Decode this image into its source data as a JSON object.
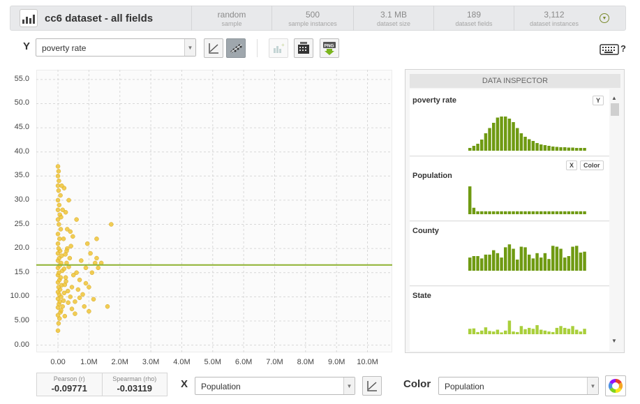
{
  "header": {
    "title": "cc6 dataset - all fields",
    "stats": [
      {
        "value": "random",
        "label": "sample"
      },
      {
        "value": "500",
        "label": "sample instances"
      },
      {
        "value": "3.1 MB",
        "label": "dataset size"
      },
      {
        "value": "189",
        "label": "dataset fields"
      },
      {
        "value": "3,112",
        "label": "dataset instances"
      }
    ]
  },
  "toolbar": {
    "y_letter": "Y",
    "y_field": "poverty rate",
    "x_letter": "X",
    "x_field": "Population",
    "color_label": "Color",
    "color_field": "Population",
    "keyboard_hint": "?"
  },
  "correlation": {
    "pearson_label": "Pearson (r)",
    "pearson_value": "-0.09771",
    "spearman_label": "Spearman (rho)",
    "spearman_value": "-0.03119"
  },
  "inspector": {
    "title": "DATA INSPECTOR",
    "fields": [
      {
        "name": "poverty rate",
        "badge": "Y",
        "bars": [
          0.08,
          0.14,
          0.2,
          0.32,
          0.5,
          0.65,
          0.8,
          0.95,
          0.98,
          0.98,
          0.92,
          0.82,
          0.65,
          0.5,
          0.4,
          0.33,
          0.28,
          0.22,
          0.18,
          0.16,
          0.14,
          0.12,
          0.11,
          0.1,
          0.1,
          0.09,
          0.09,
          0.08,
          0.08,
          0.08
        ],
        "color": "#6f9a12"
      },
      {
        "name": "Population",
        "badges": [
          "X",
          "Color"
        ],
        "bars": [
          0.95,
          0.22,
          0.1,
          0.1,
          0.1,
          0.1,
          0.1,
          0.1,
          0.1,
          0.1,
          0.1,
          0.1,
          0.1,
          0.1,
          0.1,
          0.1,
          0.1,
          0.1,
          0.1,
          0.1,
          0.1,
          0.1,
          0.1,
          0.1,
          0.1,
          0.1,
          0.1,
          0.1,
          0.1,
          0.1
        ],
        "color": "#6f9a12"
      },
      {
        "name": "County",
        "bars": [
          0.45,
          0.5,
          0.5,
          0.42,
          0.55,
          0.55,
          0.7,
          0.6,
          0.45,
          0.8,
          0.9,
          0.75,
          0.38,
          0.82,
          0.8,
          0.55,
          0.42,
          0.6,
          0.45,
          0.6,
          0.4,
          0.85,
          0.82,
          0.75,
          0.45,
          0.5,
          0.82,
          0.85,
          0.62,
          0.65
        ],
        "color": "#6f9a12"
      },
      {
        "name": "State",
        "bars": [
          0.3,
          0.32,
          0.12,
          0.2,
          0.38,
          0.18,
          0.15,
          0.25,
          0.1,
          0.2,
          0.75,
          0.15,
          0.12,
          0.45,
          0.28,
          0.35,
          0.3,
          0.5,
          0.25,
          0.2,
          0.15,
          0.12,
          0.35,
          0.45,
          0.35,
          0.3,
          0.45,
          0.25,
          0.15,
          0.3
        ],
        "color": "#a9cf3b"
      }
    ]
  },
  "chart_data": {
    "type": "scatter",
    "title": "",
    "xlabel": "Population",
    "ylabel": "poverty rate",
    "xlim": [
      -0.7,
      10.8
    ],
    "ylim": [
      -1.5,
      57.0
    ],
    "x_ticks": [
      "0.00",
      "1.0M",
      "2.0M",
      "3.0M",
      "4.0M",
      "5.0M",
      "6.0M",
      "7.0M",
      "8.0M",
      "9.0M",
      "10.0M"
    ],
    "y_ticks": [
      "0.00",
      "5.00",
      "10.00",
      "15.0",
      "20.0",
      "25.0",
      "30.0",
      "35.0",
      "40.0",
      "45.0",
      "50.0",
      "55.0"
    ],
    "x_units": "millions",
    "mean_line_y": 16.6,
    "mean_line_color": "#8db230",
    "point_color": "#efc437",
    "grid": true,
    "points": [
      [
        0.0,
        3.0
      ],
      [
        0.02,
        4.5
      ],
      [
        0.05,
        5.5
      ],
      [
        0.0,
        6.2
      ],
      [
        0.08,
        6.8
      ],
      [
        0.1,
        7.2
      ],
      [
        0.0,
        7.8
      ],
      [
        0.03,
        8.5
      ],
      [
        0.06,
        9.0
      ],
      [
        0.0,
        9.6
      ],
      [
        0.1,
        10.0
      ],
      [
        0.04,
        10.5
      ],
      [
        0.0,
        11.0
      ],
      [
        0.07,
        11.5
      ],
      [
        0.02,
        12.0
      ],
      [
        0.12,
        12.4
      ],
      [
        0.0,
        13.0
      ],
      [
        0.05,
        13.5
      ],
      [
        0.09,
        14.0
      ],
      [
        0.0,
        14.5
      ],
      [
        0.03,
        15.0
      ],
      [
        0.14,
        15.4
      ],
      [
        0.0,
        16.0
      ],
      [
        0.06,
        16.5
      ],
      [
        0.1,
        17.0
      ],
      [
        0.0,
        17.5
      ],
      [
        0.04,
        18.0
      ],
      [
        0.12,
        18.5
      ],
      [
        0.0,
        19.0
      ],
      [
        0.07,
        19.5
      ],
      [
        0.02,
        20.0
      ],
      [
        0.0,
        21.0
      ],
      [
        0.05,
        22.0
      ],
      [
        0.0,
        23.0
      ],
      [
        0.09,
        24.0
      ],
      [
        0.03,
        25.0
      ],
      [
        0.0,
        26.0
      ],
      [
        0.06,
        27.0
      ],
      [
        0.0,
        28.0
      ],
      [
        0.04,
        29.0
      ],
      [
        0.0,
        30.0
      ],
      [
        0.08,
        31.0
      ],
      [
        0.02,
        32.0
      ],
      [
        0.0,
        33.0
      ],
      [
        0.03,
        34.0
      ],
      [
        0.0,
        35.0
      ],
      [
        0.02,
        36.0
      ],
      [
        0.0,
        37.0
      ],
      [
        0.15,
        8.0
      ],
      [
        0.18,
        9.2
      ],
      [
        0.2,
        10.8
      ],
      [
        0.22,
        12.5
      ],
      [
        0.25,
        14.0
      ],
      [
        0.2,
        15.8
      ],
      [
        0.28,
        17.0
      ],
      [
        0.24,
        18.8
      ],
      [
        0.3,
        20.0
      ],
      [
        0.18,
        22.0
      ],
      [
        0.26,
        13.2
      ],
      [
        0.32,
        11.2
      ],
      [
        0.22,
        6.0
      ],
      [
        0.35,
        16.2
      ],
      [
        0.4,
        10.0
      ],
      [
        0.45,
        12.0
      ],
      [
        0.5,
        14.5
      ],
      [
        0.38,
        18.0
      ],
      [
        0.55,
        9.0
      ],
      [
        0.6,
        15.0
      ],
      [
        0.42,
        20.5
      ],
      [
        0.48,
        22.5
      ],
      [
        0.3,
        24.0
      ],
      [
        0.25,
        27.5
      ],
      [
        0.35,
        30.0
      ],
      [
        0.2,
        32.5
      ],
      [
        0.65,
        11.5
      ],
      [
        0.7,
        13.5
      ],
      [
        0.75,
        17.5
      ],
      [
        0.8,
        10.5
      ],
      [
        0.85,
        8.0
      ],
      [
        0.9,
        16.0
      ],
      [
        1.0,
        7.0
      ],
      [
        1.0,
        12.0
      ],
      [
        1.05,
        19.0
      ],
      [
        0.95,
        21.0
      ],
      [
        0.6,
        26.0
      ],
      [
        0.55,
        6.5
      ],
      [
        1.1,
        15.0
      ],
      [
        1.2,
        17.0
      ],
      [
        1.25,
        22.0
      ],
      [
        1.3,
        16.0
      ],
      [
        1.15,
        9.5
      ],
      [
        1.4,
        17.0
      ],
      [
        1.25,
        18.0
      ],
      [
        1.6,
        8.0
      ],
      [
        1.72,
        25.0
      ],
      [
        0.45,
        7.5
      ],
      [
        0.15,
        28.0
      ],
      [
        0.12,
        33.0
      ],
      [
        0.1,
        26.5
      ],
      [
        0.33,
        8.8
      ],
      [
        0.28,
        19.5
      ],
      [
        0.4,
        23.5
      ],
      [
        0.7,
        9.8
      ],
      [
        0.9,
        12.8
      ]
    ]
  }
}
